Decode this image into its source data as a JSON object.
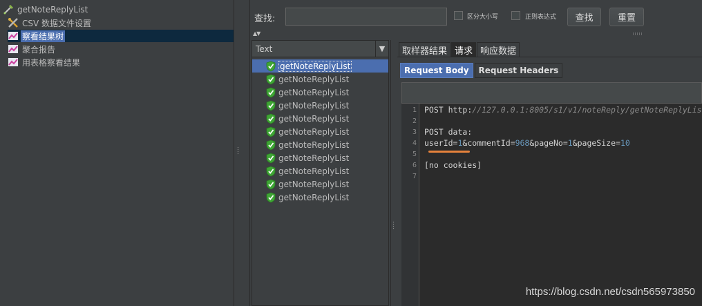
{
  "tree": {
    "items": [
      {
        "label": "getNoteReplyList",
        "icon": "sampler-pipette-icon"
      },
      {
        "label": "CSV 数据文件设置",
        "icon": "config-tools-icon"
      },
      {
        "label": "察看结果树",
        "icon": "listener-chart-icon",
        "selected": true
      },
      {
        "label": "聚合报告",
        "icon": "listener-chart-icon"
      },
      {
        "label": "用表格察看结果",
        "icon": "listener-chart-icon"
      }
    ]
  },
  "search": {
    "label": "查找:",
    "value": "",
    "case_sensitive_label": "区分大小写",
    "regex_label": "正则表达式",
    "find_button": "查找",
    "reset_button": "重置"
  },
  "results_list": {
    "renderer": "Text",
    "samples": [
      "getNoteReplyList",
      "getNoteReplyList",
      "getNoteReplyList",
      "getNoteReplyList",
      "getNoteReplyList",
      "getNoteReplyList",
      "getNoteReplyList",
      "getNoteReplyList",
      "getNoteReplyList",
      "getNoteReplyList",
      "getNoteReplyList"
    ],
    "status_icon": "success-shield-icon"
  },
  "detail_tabs": [
    "取样器结果",
    "请求",
    "响应数据"
  ],
  "active_detail_tab": "请求",
  "sub_tabs": [
    "Request Body",
    "Request Headers"
  ],
  "active_sub_tab": "Request Body",
  "editor": {
    "line_numbers": [
      "1",
      "2",
      "3",
      "4",
      "5",
      "6",
      "7"
    ],
    "lines": {
      "l1_method": "POST ",
      "l1_scheme": "http:",
      "l1_url": "//127.0.0.1:8005/s1/v1/noteReply/getNoteReplyList",
      "l3": "POST data:",
      "l4_k1": "userId=",
      "l4_v1": "1",
      "l4_k2": "&commentId=",
      "l4_v2": "968",
      "l4_k3": "&pageNo=",
      "l4_v3": "1",
      "l4_k4": "&pageSize=",
      "l4_v4": "10",
      "l6": "[no cookies]"
    }
  },
  "watermark": "https://blog.csdn.net/csdn565973850",
  "colors": {
    "background": "#3c3f41",
    "selection": "#4b6eaf",
    "editor_bg": "#2b2b2b",
    "number": "#6897bb",
    "underline_accent": "#e6823c",
    "success_green": "#3fa535"
  }
}
